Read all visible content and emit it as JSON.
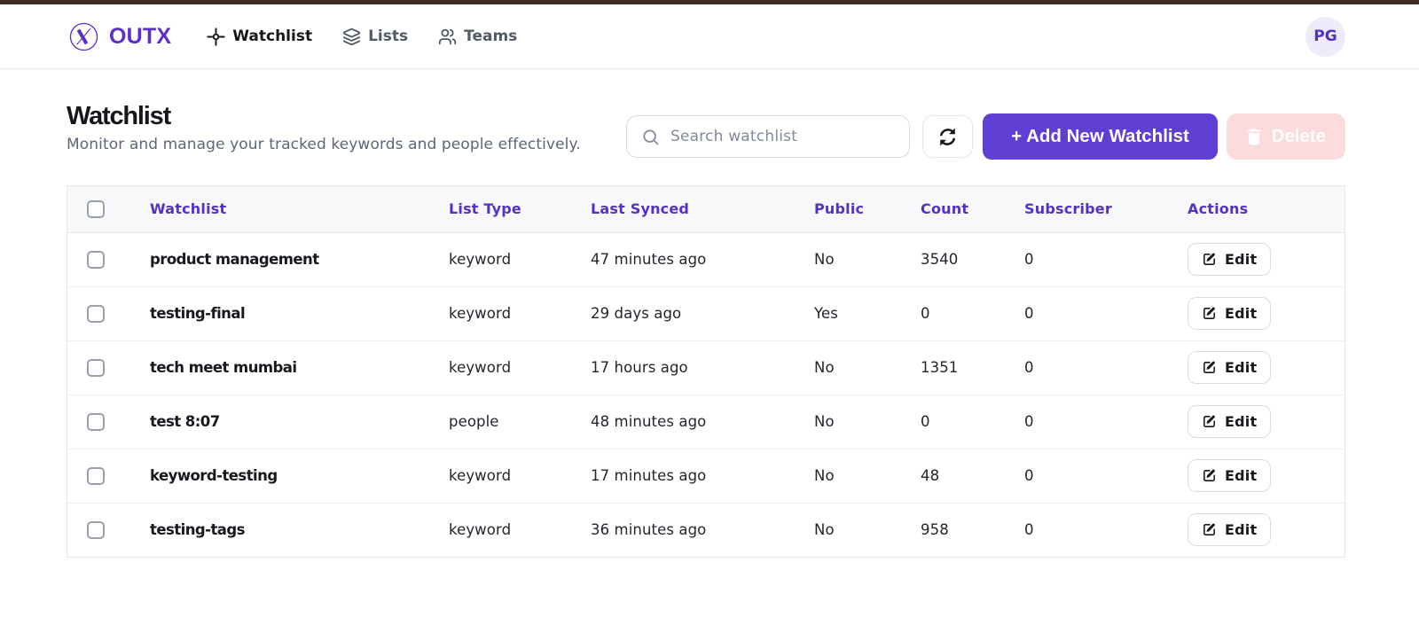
{
  "brand": {
    "name": "OUTX"
  },
  "nav": {
    "items": [
      {
        "label": "Watchlist",
        "icon": "crosshair-icon",
        "active": true
      },
      {
        "label": "Lists",
        "icon": "layers-icon",
        "active": false
      },
      {
        "label": "Teams",
        "icon": "users-icon",
        "active": false
      }
    ]
  },
  "user": {
    "initials": "PG"
  },
  "page": {
    "title": "Watchlist",
    "subtitle": "Monitor and manage your tracked keywords and people effectively."
  },
  "toolbar": {
    "search_placeholder": "Search watchlist",
    "search_value": "",
    "add_label": "+ Add New Watchlist",
    "delete_label": "Delete"
  },
  "table": {
    "headers": [
      "Watchlist",
      "List Type",
      "Last Synced",
      "Public",
      "Count",
      "Subscriber",
      "Actions"
    ],
    "edit_label": "Edit",
    "rows": [
      {
        "name": "product management",
        "list_type": "keyword",
        "last_synced": "47 minutes ago",
        "public": "No",
        "count": "3540",
        "subscriber": "0"
      },
      {
        "name": "testing-final",
        "list_type": "keyword",
        "last_synced": "29 days ago",
        "public": "Yes",
        "count": "0",
        "subscriber": "0"
      },
      {
        "name": "tech meet mumbai",
        "list_type": "keyword",
        "last_synced": "17 hours ago",
        "public": "No",
        "count": "1351",
        "subscriber": "0"
      },
      {
        "name": "test 8:07",
        "list_type": "people",
        "last_synced": "48 minutes ago",
        "public": "No",
        "count": "0",
        "subscriber": "0"
      },
      {
        "name": "keyword-testing",
        "list_type": "keyword",
        "last_synced": "17 minutes ago",
        "public": "No",
        "count": "48",
        "subscriber": "0"
      },
      {
        "name": "testing-tags",
        "list_type": "keyword",
        "last_synced": "36 minutes ago",
        "public": "No",
        "count": "958",
        "subscriber": "0"
      }
    ]
  },
  "colors": {
    "brand_purple": "#5b2fc9",
    "button_purple": "#5e3cd2",
    "header_purple": "#5431c6",
    "delete_pink": "#fbdbdb",
    "top_strip": "#3d2b21"
  }
}
